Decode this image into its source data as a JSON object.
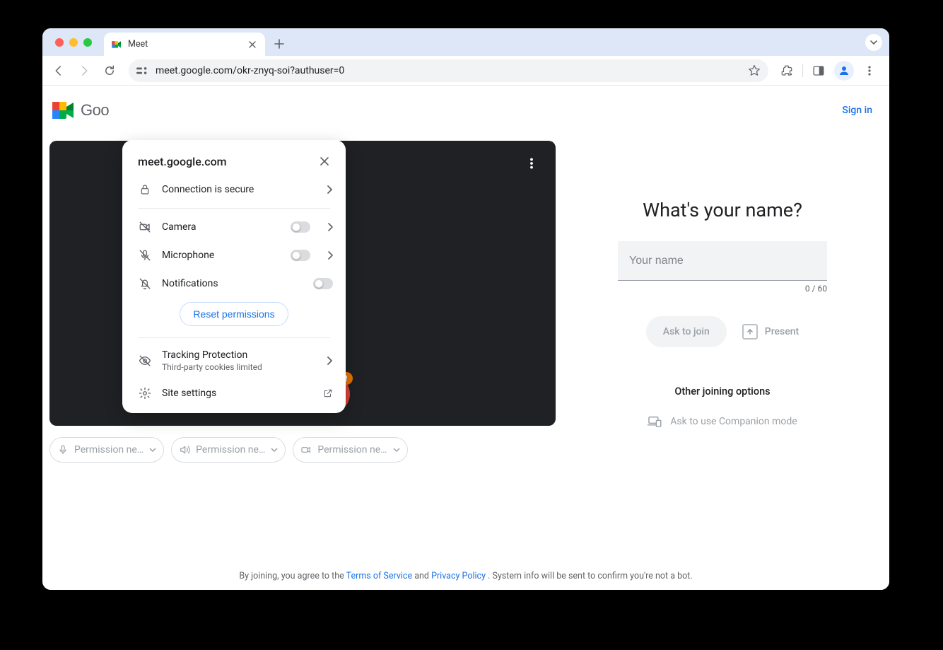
{
  "browser": {
    "tab_title": "Meet",
    "url": "meet.google.com/okr-znyq-soi?authuser=0"
  },
  "page_header": {
    "brand_text": "Goo",
    "sign_in": "Sign in"
  },
  "popover": {
    "host": "meet.google.com",
    "connection": "Connection is secure",
    "camera": "Camera",
    "microphone": "Microphone",
    "notifications": "Notifications",
    "reset": "Reset permissions",
    "tracking_title": "Tracking Protection",
    "tracking_sub": "Third-party cookies limited",
    "site_settings": "Site settings"
  },
  "perm_chips": {
    "mic": "Permission ne…",
    "speaker": "Permission ne…",
    "camera": "Permission ne…"
  },
  "join": {
    "title": "What's your name?",
    "placeholder": "Your name",
    "char_count": "0 / 60",
    "ask": "Ask to join",
    "present": "Present",
    "other": "Other joining options",
    "companion": "Ask to use Companion mode"
  },
  "footer": {
    "prefix": "By joining, you agree to the ",
    "tos": "Terms of Service",
    "and": " and ",
    "privacy": "Privacy Policy",
    "suffix": ". System info will be sent to confirm you're not a bot."
  }
}
